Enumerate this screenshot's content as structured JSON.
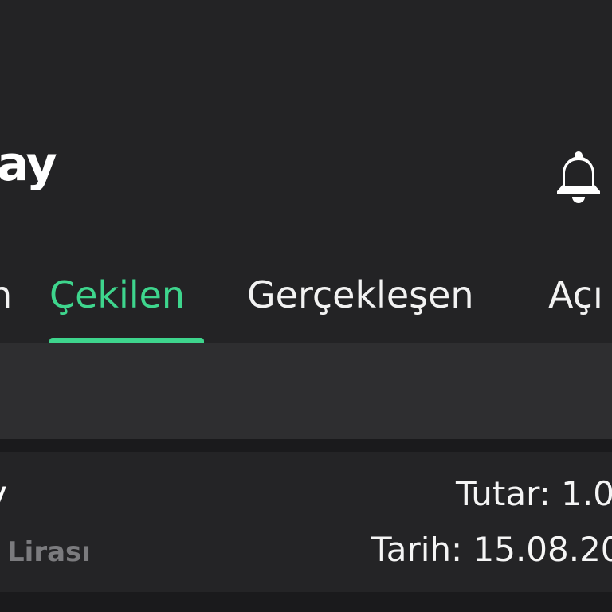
{
  "header": {
    "logo_text": "ay",
    "notification_icon": "bell-icon"
  },
  "tabs": [
    {
      "label": "n",
      "active": false
    },
    {
      "label": "Çekilen",
      "active": true
    },
    {
      "label": "Gerçekleşen",
      "active": false
    },
    {
      "label": "Açı",
      "active": false
    }
  ],
  "transaction": {
    "title_fragment": "y",
    "currency_fragment": "Lirası",
    "amount_label": "Tutar: 1.0",
    "date_label": "Tarih: 15.08.20"
  },
  "colors": {
    "background": "#232325",
    "accent": "#3ed58d",
    "band": "#2e2e30"
  }
}
